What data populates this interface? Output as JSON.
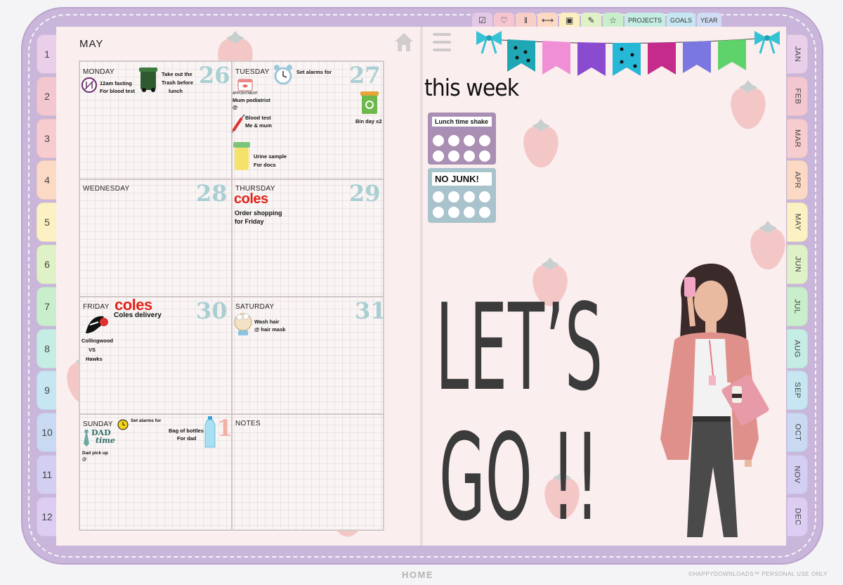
{
  "left_tabs": [
    {
      "label": "1",
      "color": "#e9cfe9"
    },
    {
      "label": "2",
      "color": "#f3c7cf"
    },
    {
      "label": "3",
      "color": "#f7cccf"
    },
    {
      "label": "4",
      "color": "#fbd9c4"
    },
    {
      "label": "5",
      "color": "#fbf1c2"
    },
    {
      "label": "6",
      "color": "#dff1c6"
    },
    {
      "label": "7",
      "color": "#c9eecb"
    },
    {
      "label": "8",
      "color": "#c6ede3"
    },
    {
      "label": "9",
      "color": "#c6e6f1"
    },
    {
      "label": "10",
      "color": "#c9d9f2"
    },
    {
      "label": "11",
      "color": "#d3cff2"
    },
    {
      "label": "12",
      "color": "#ddcdf2"
    }
  ],
  "right_tabs": [
    {
      "label": "JAN",
      "color": "#e9cfe9"
    },
    {
      "label": "FEB",
      "color": "#f3c7cf"
    },
    {
      "label": "MAR",
      "color": "#f7cccf"
    },
    {
      "label": "APR",
      "color": "#fbd9c4"
    },
    {
      "label": "MAY",
      "color": "#fbf1c2"
    },
    {
      "label": "JUN",
      "color": "#dff1c6"
    },
    {
      "label": "JUL",
      "color": "#c9eecb"
    },
    {
      "label": "AUG",
      "color": "#c6ede3"
    },
    {
      "label": "SEP",
      "color": "#c6e6f1"
    },
    {
      "label": "OCT",
      "color": "#c9d9f2"
    },
    {
      "label": "NOV",
      "color": "#d3cff2"
    },
    {
      "label": "DEC",
      "color": "#ddcdf2"
    }
  ],
  "top_tabs": [
    {
      "icon": "checkbox-icon",
      "color": "#e4c9e7",
      "label": "☑"
    },
    {
      "icon": "heartbeat-icon",
      "color": "#f5c6cf",
      "label": "♡"
    },
    {
      "icon": "cutlery-icon",
      "color": "#f8cfc8",
      "label": "ǁ"
    },
    {
      "icon": "dumbbell-icon",
      "color": "#fcd9c3",
      "label": "⟷"
    },
    {
      "icon": "money-icon",
      "color": "#fbeec0",
      "label": "▣"
    },
    {
      "icon": "notes-icon",
      "color": "#e1f1c6",
      "label": "✎"
    },
    {
      "icon": "star-icon",
      "color": "#c9eecb",
      "label": "☆"
    }
  ],
  "top_text_tabs": [
    {
      "label": "PROJECTS",
      "color": "#c6ede3"
    },
    {
      "label": "GOALS",
      "color": "#c6e6f1"
    },
    {
      "label": "YEAR",
      "color": "#d0dcf3"
    }
  ],
  "month": "MAY",
  "days": {
    "monday": {
      "name": "MONDAY",
      "num": "26",
      "notes": [
        "12am fasting",
        "For blood test"
      ],
      "notes2": [
        "Take out the",
        "Trash before",
        "lunch"
      ]
    },
    "tuesday": {
      "name": "TUESDAY",
      "num": "27",
      "notes": [
        "Set alarms for"
      ],
      "appt": "APPOINTMENT",
      "notes2": [
        "Mum podiatrist",
        "@"
      ],
      "notes3": [
        "Blood test",
        "Me & mum"
      ],
      "notes4": [
        "Urine sample",
        "For docs"
      ],
      "notes5": [
        "Bin day x2"
      ]
    },
    "wednesday": {
      "name": "WEDNESDAY",
      "num": "28"
    },
    "thursday": {
      "name": "THURSDAY",
      "num": "29",
      "brand": "coles",
      "notes": [
        "Order shopping",
        "for Friday"
      ]
    },
    "friday": {
      "name": "FRIDAY",
      "num": "30",
      "brand": "coles",
      "headline": "Coles delivery",
      "notes": [
        "Collingwood",
        "VS",
        "Hawks"
      ]
    },
    "saturday": {
      "name": "SATURDAY",
      "num": "31",
      "notes": [
        "Wash hair",
        "@ hair mask"
      ]
    },
    "sunday": {
      "name": "SUNDAY",
      "num": "1",
      "notes": [
        "Set alarms for"
      ],
      "notes2": [
        "Bag of bottles",
        "For dad"
      ],
      "dad1": "DAD",
      "dad2": "time",
      "notes3": [
        "Dad pick up",
        "@"
      ]
    },
    "notes": {
      "name": "NOTES"
    }
  },
  "this_week": "this week",
  "trackers": [
    {
      "label": "Lunch time shake",
      "color": "#a98fb3"
    },
    {
      "label": "NO JUNK!",
      "color": "#a8c3cc"
    }
  ],
  "headline1": "LET’S",
  "headline2": "GO !!",
  "footer": {
    "home": "HOME",
    "copyright": "©HAPPYDOWNLOADS™ PERSONAL USE ONLY"
  }
}
